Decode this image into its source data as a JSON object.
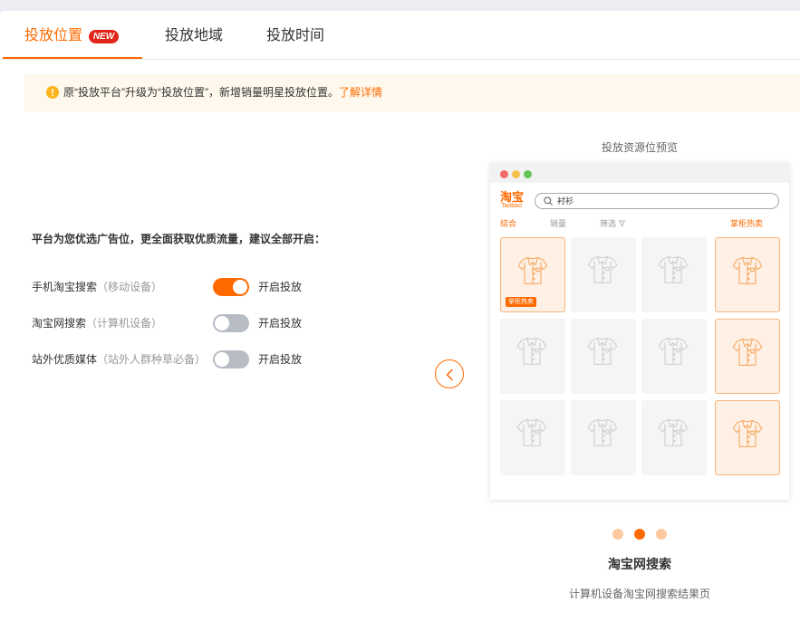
{
  "tabs": [
    {
      "label": "投放位置",
      "badge": "NEW",
      "active": true
    },
    {
      "label": "投放地域",
      "active": false
    },
    {
      "label": "投放时间",
      "active": false
    }
  ],
  "notice": {
    "icon": "exclamation-circle-icon",
    "text": "原“投放平台”升级为“投放位置”，新增销量明星投放位置。",
    "link": "了解详情"
  },
  "placements": {
    "intro": "平台为您优选广告位，更全面获取优质流量，建议全部开启：",
    "items": [
      {
        "name": "手机淘宝搜索",
        "device": "（移动设备）",
        "enabled": true,
        "toggle_label": "开启投放"
      },
      {
        "name": "淘宝网搜索",
        "device": "（计算机设备）",
        "enabled": false,
        "toggle_label": "开启投放"
      },
      {
        "name": "站外优质媒体",
        "device": "（站外人群种草必备）",
        "enabled": false,
        "toggle_label": "开启投放"
      }
    ]
  },
  "preview": {
    "title": "投放资源位预览",
    "prev_button_icon": "chevron-left-icon",
    "logo": "淘宝",
    "logo_sub": "Taobao",
    "search_icon": "search-icon",
    "search_value": "衬衫",
    "filters": [
      {
        "label": "综合",
        "active": true
      },
      {
        "label": "销量",
        "active": false
      },
      {
        "label": "筛选",
        "active": false,
        "icon": "filter-icon"
      },
      {
        "label": "掌柜热卖",
        "active": true
      }
    ],
    "product_icon": "shirt-icon",
    "products": [
      {
        "highlighted": true,
        "badge": "掌柜热卖"
      },
      {
        "highlighted": false
      },
      {
        "highlighted": false
      },
      {
        "highlighted": true
      },
      {
        "highlighted": false
      },
      {
        "highlighted": false
      },
      {
        "highlighted": false
      },
      {
        "highlighted": true
      },
      {
        "highlighted": false
      },
      {
        "highlighted": false
      },
      {
        "highlighted": false
      },
      {
        "highlighted": true
      }
    ],
    "carousel": [
      {
        "active": false
      },
      {
        "active": true
      },
      {
        "active": false
      }
    ],
    "caption_title": "淘宝网搜索",
    "caption_desc": "计算机设备淘宝网搜索结果页"
  },
  "colors": {
    "accent": "#ff6a00",
    "new_badge": "#e1251b",
    "notice_bg": "#fff8ec",
    "notice_icon": "#fbb41d",
    "toggle_off": "#b8bcc4",
    "slot_bg": "#f5f5f5",
    "slot_highlight_bg": "#fff0e5",
    "slot_highlight_border": "#f8b57c",
    "carousel_dot": "#fdc9a0",
    "mac_red": "#f26b6b",
    "mac_yellow": "#f5c04a",
    "mac_green": "#62c554"
  }
}
